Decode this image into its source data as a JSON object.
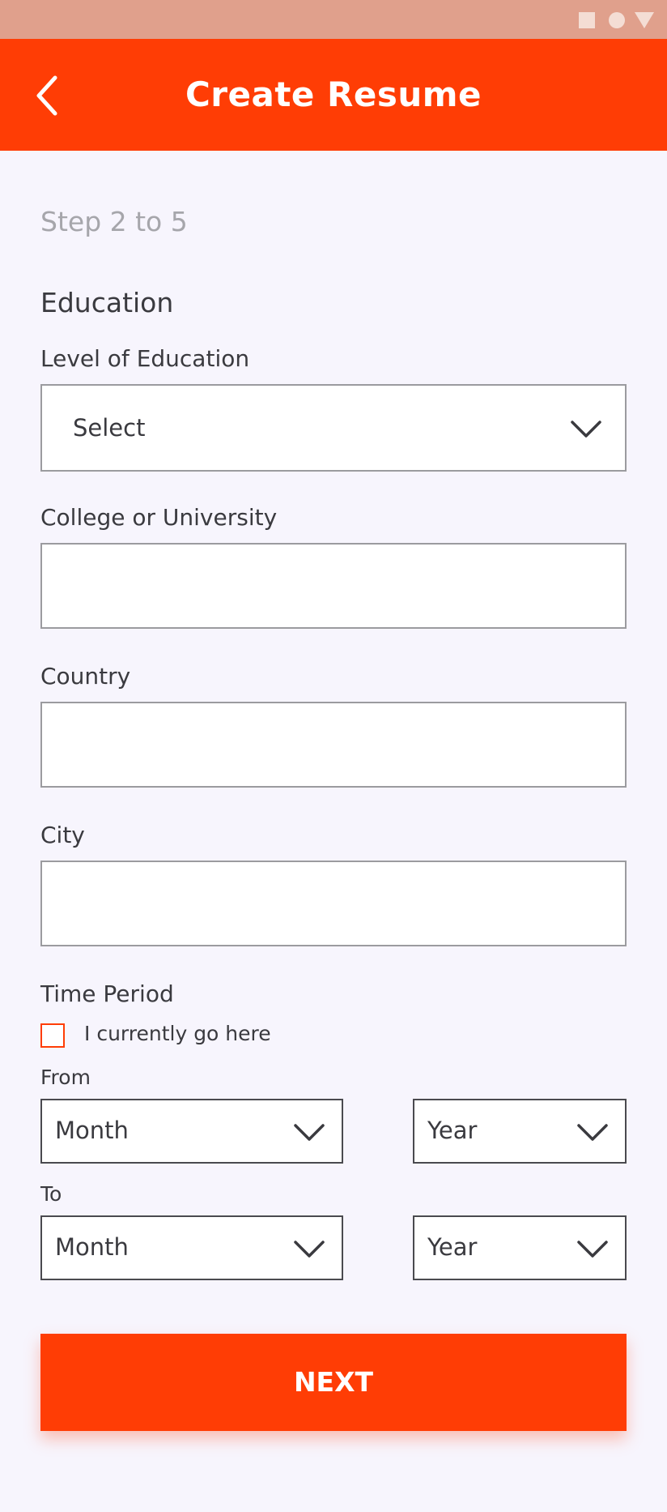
{
  "colors": {
    "accent": "#ff3d05",
    "status_bar": "#e0a08c",
    "background": "#f7f5fd"
  },
  "header": {
    "title": "Create Resume",
    "back_icon": "chevron-left-icon"
  },
  "form": {
    "step": "Step 2 to 5",
    "section_title": "Education",
    "level_of_education": {
      "label": "Level of Education",
      "value": "Select"
    },
    "college": {
      "label": "College or University",
      "value": "",
      "placeholder": ""
    },
    "country": {
      "label": "Country",
      "value": "",
      "placeholder": ""
    },
    "city": {
      "label": "City",
      "value": "",
      "placeholder": ""
    },
    "time_period": {
      "label": "Time Period",
      "current_checkbox_label": "I currently go here",
      "current_checked": false,
      "from_label": "From",
      "from_month": "Month",
      "from_year": "Year",
      "to_label": "To",
      "to_month": "Month",
      "to_year": "Year"
    }
  },
  "actions": {
    "next_label": "NEXT"
  }
}
